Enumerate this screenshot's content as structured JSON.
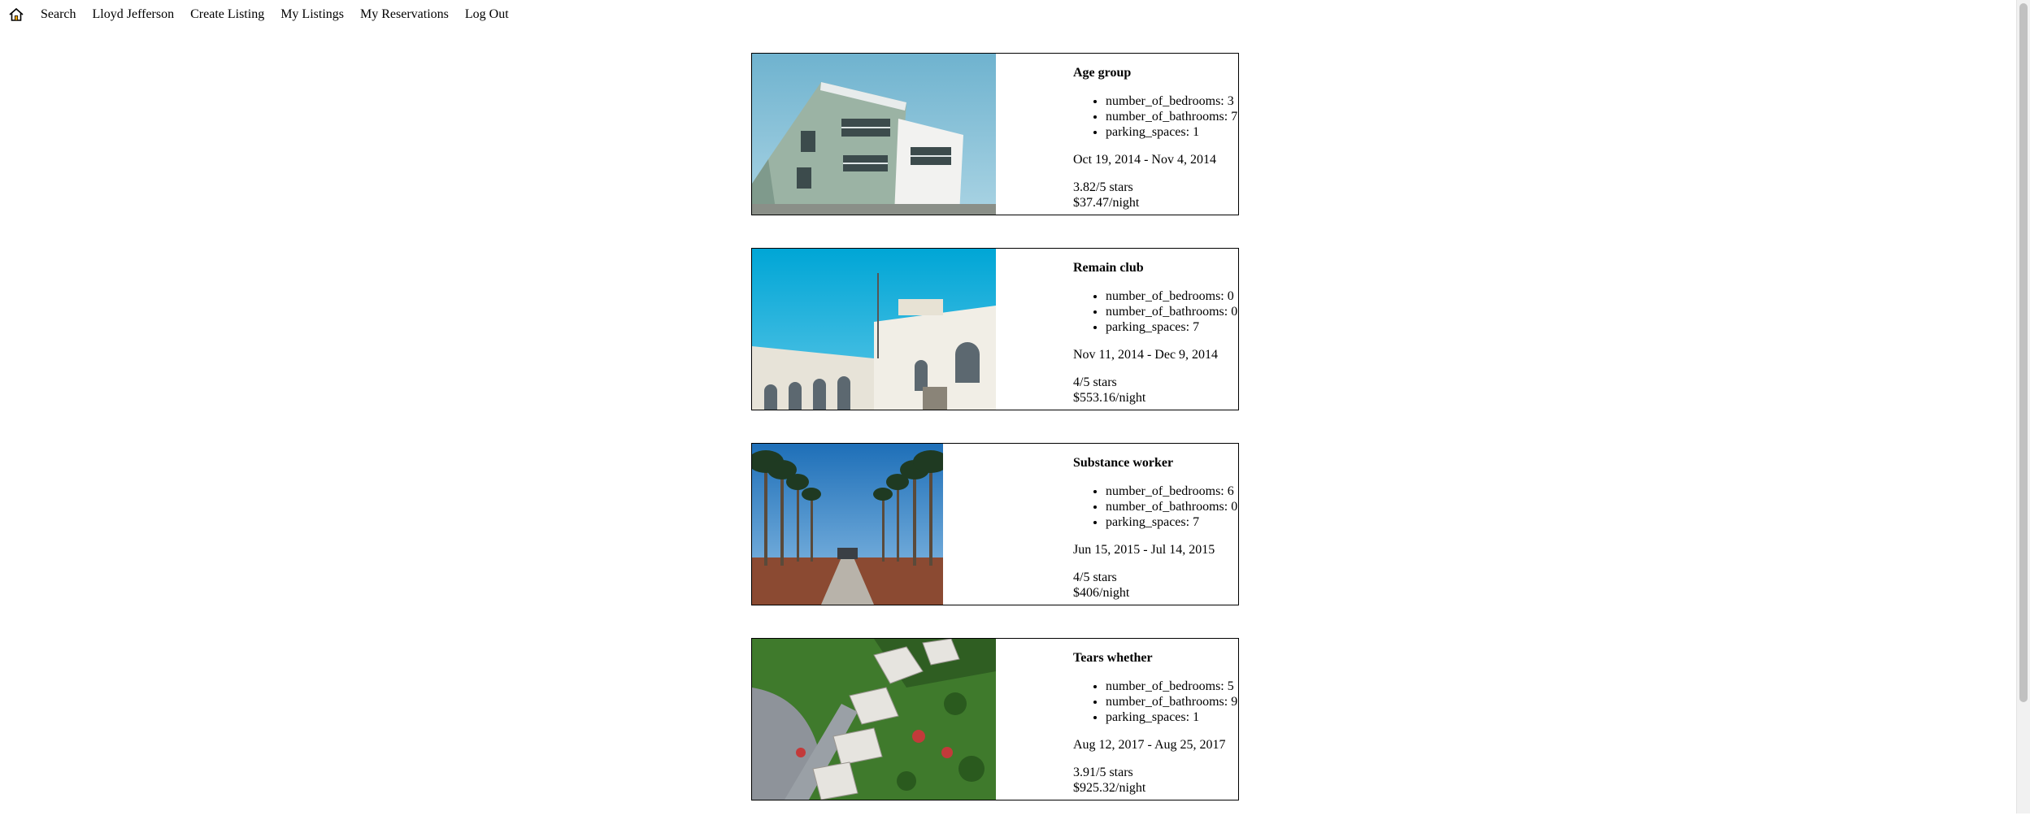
{
  "nav": {
    "home_icon": "home-icon",
    "links": [
      "Search",
      "Lloyd Jefferson",
      "Create Listing",
      "My Listings",
      "My Reservations",
      "Log Out"
    ]
  },
  "listings": [
    {
      "title": "Age group",
      "photo": "building-photo",
      "features": [
        "number_of_bedrooms: 3",
        "number_of_bathrooms: 7",
        "parking_spaces: 1"
      ],
      "dates": "Oct 19, 2014 - Nov 4, 2014",
      "rating": "3.82/5 stars",
      "price": "$37.47/night"
    },
    {
      "title": "Remain club",
      "photo": "building-photo",
      "features": [
        "number_of_bedrooms: 0",
        "number_of_bathrooms: 0",
        "parking_spaces: 7"
      ],
      "dates": "Nov 11, 2014 - Dec 9, 2014",
      "rating": "4/5 stars",
      "price": "$553.16/night"
    },
    {
      "title": "Substance worker",
      "photo": "palm-path-photo",
      "features": [
        "number_of_bedrooms: 6",
        "number_of_bathrooms: 0",
        "parking_spaces: 7"
      ],
      "dates": "Jun 15, 2015 - Jul 14, 2015",
      "rating": "4/5 stars",
      "price": "$406/night"
    },
    {
      "title": "Tears whether",
      "photo": "aerial-houses-photo",
      "features": [
        "number_of_bedrooms: 5",
        "number_of_bathrooms: 9",
        "parking_spaces: 1"
      ],
      "dates": "Aug 12, 2017 - Aug 25, 2017",
      "rating": "3.91/5 stars",
      "price": "$925.32/night"
    }
  ]
}
